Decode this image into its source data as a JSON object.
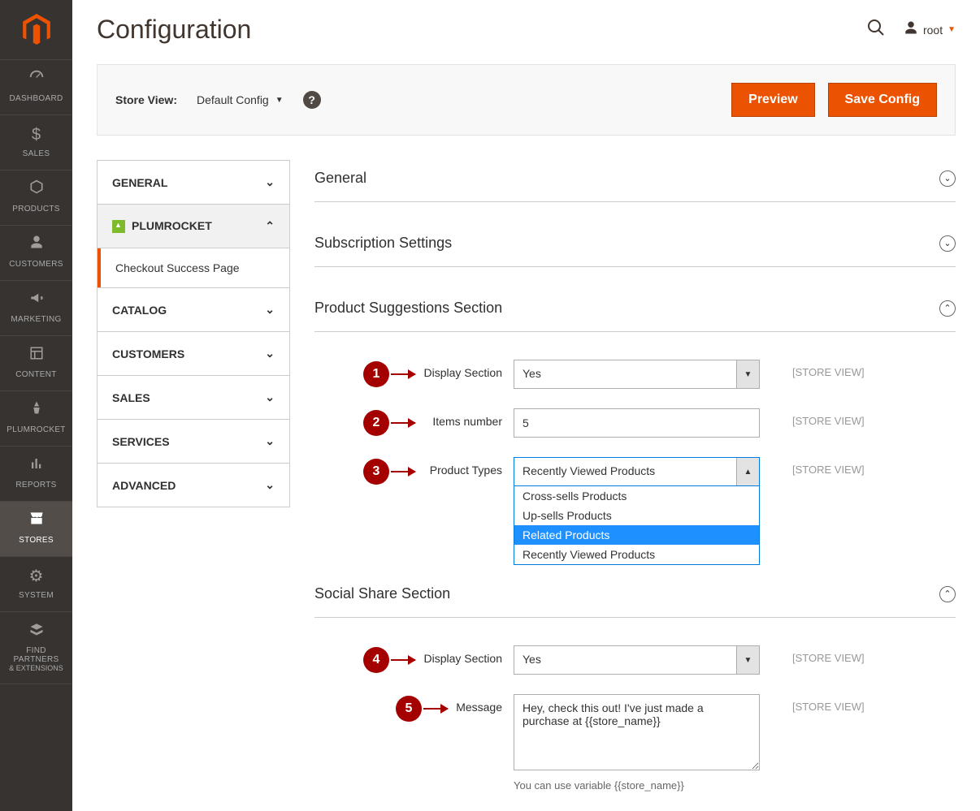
{
  "page": {
    "title": "Configuration"
  },
  "user": {
    "name": "root"
  },
  "sidebar": {
    "items": [
      {
        "label": "DASHBOARD"
      },
      {
        "label": "SALES"
      },
      {
        "label": "PRODUCTS"
      },
      {
        "label": "CUSTOMERS"
      },
      {
        "label": "MARKETING"
      },
      {
        "label": "CONTENT"
      },
      {
        "label": "PLUMROCKET"
      },
      {
        "label": "REPORTS"
      },
      {
        "label": "STORES"
      },
      {
        "label": "SYSTEM"
      },
      {
        "label": "FIND PARTNERS",
        "sub": "& EXTENSIONS"
      }
    ]
  },
  "storebar": {
    "label": "Store View:",
    "value": "Default Config",
    "preview_btn": "Preview",
    "save_btn": "Save Config"
  },
  "confignav": {
    "general": "GENERAL",
    "plumrocket": "PLUMROCKET",
    "sub_checkout": "Checkout Success Page",
    "catalog": "CATALOG",
    "customers": "CUSTOMERS",
    "sales": "SALES",
    "services": "SERVICES",
    "advanced": "ADVANCED"
  },
  "sections": {
    "general": "General",
    "subscription": "Subscription Settings",
    "product_suggestions": "Product Suggestions Section",
    "social_share": "Social Share Section"
  },
  "fields": {
    "display_section_label": "Display Section",
    "display_section_value": "Yes",
    "items_number_label": "Items number",
    "items_number_value": "5",
    "product_types_label": "Product Types",
    "product_types_value": "Recently Viewed Products",
    "product_types_options": {
      "o1": "Cross-sells Products",
      "o2": "Up-sells Products",
      "o3": "Related Products",
      "o4": "Recently Viewed Products"
    },
    "social_display_label": "Display Section",
    "social_display_value": "Yes",
    "message_label": "Message",
    "message_value": "Hey, check this out! I've just made a purchase at {{store_name}}",
    "message_hint": "You can use variable {{store_name}}",
    "scope": "[STORE VIEW]"
  },
  "callouts": {
    "c1": "1",
    "c2": "2",
    "c3": "3",
    "c4": "4",
    "c5": "5"
  }
}
